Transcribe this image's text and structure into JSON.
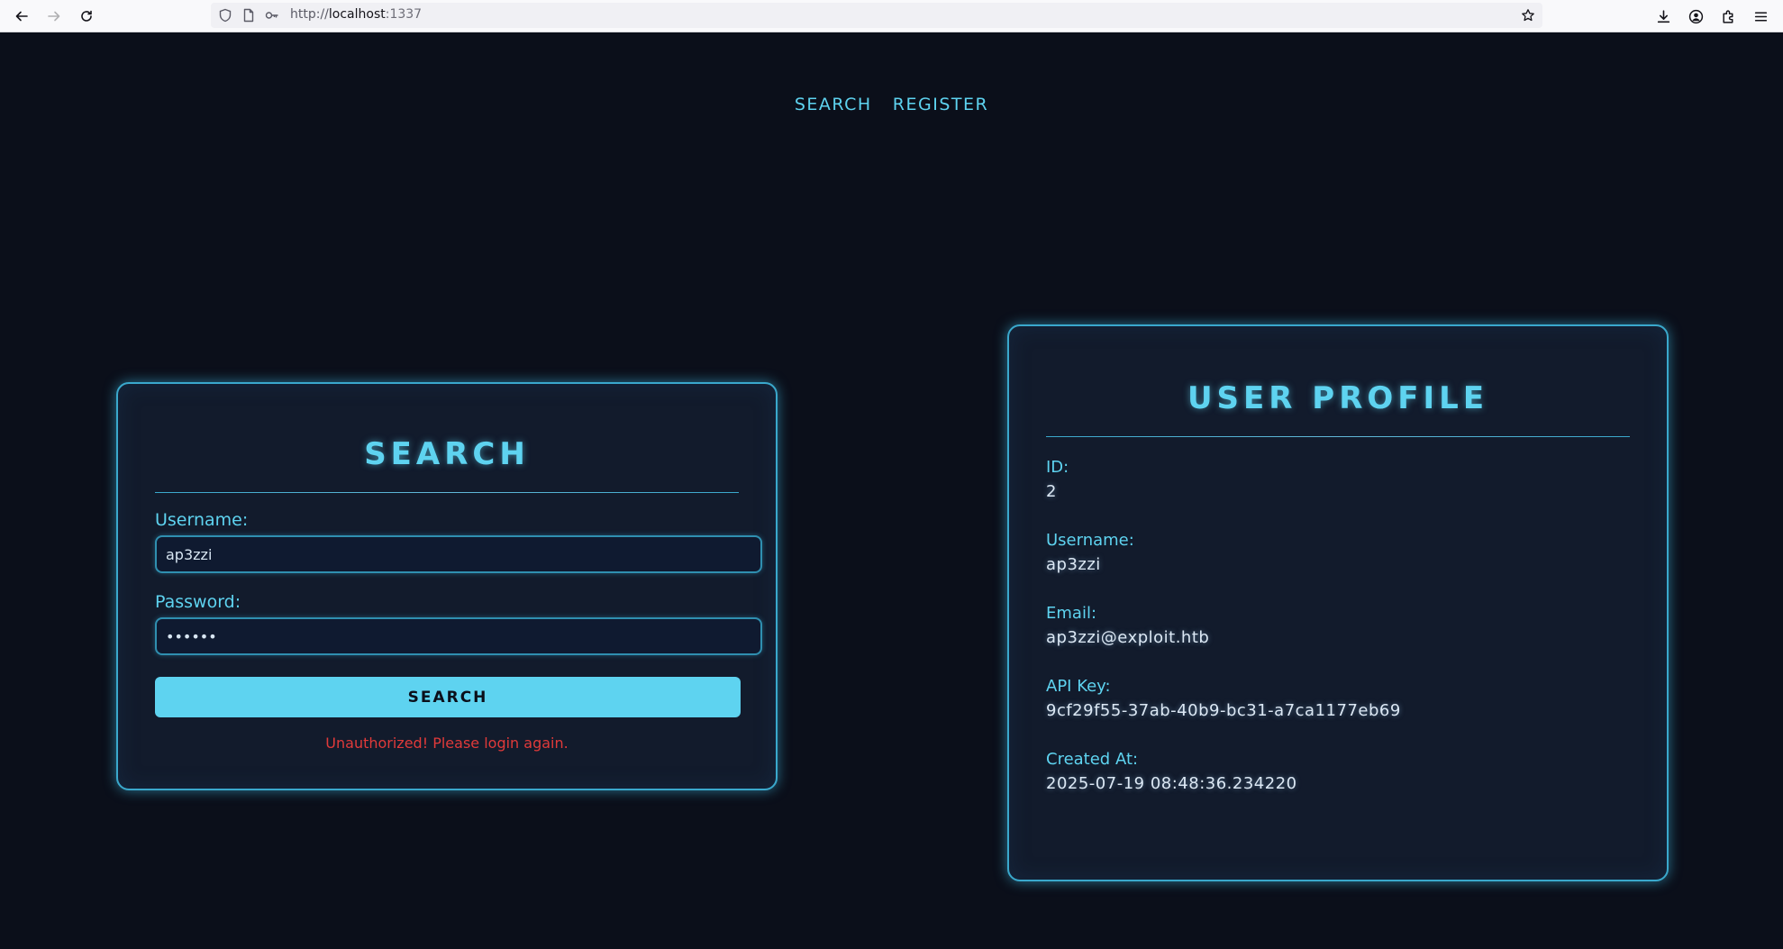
{
  "browser": {
    "url_prefix": "http://",
    "url_host": "localhost",
    "url_port": ":1337"
  },
  "nav": {
    "links": [
      "SEARCH",
      "REGISTER"
    ]
  },
  "search_form": {
    "title": "SEARCH",
    "username_label": "Username:",
    "username_value": "ap3zzi",
    "password_label": "Password:",
    "password_value": "••••••",
    "submit_label": "SEARCH",
    "error_message": "Unauthorized! Please login again."
  },
  "profile": {
    "title": "USER PROFILE",
    "fields": [
      {
        "label": "ID:",
        "value": "2"
      },
      {
        "label": "Username:",
        "value": "ap3zzi"
      },
      {
        "label": "Email:",
        "value": "ap3zzi@exploit.htb"
      },
      {
        "label": "API Key:",
        "value": "9cf29f55-37ab-40b9-bc31-a7ca1177eb69"
      },
      {
        "label": "Created At:",
        "value": "2025-07-19 08:48:36.234220"
      }
    ]
  },
  "colors": {
    "accent": "#5ed3f0",
    "background": "#0b0f1a",
    "card": "#121b2c",
    "border": "#3aa8cc",
    "error": "#e03a3a"
  }
}
